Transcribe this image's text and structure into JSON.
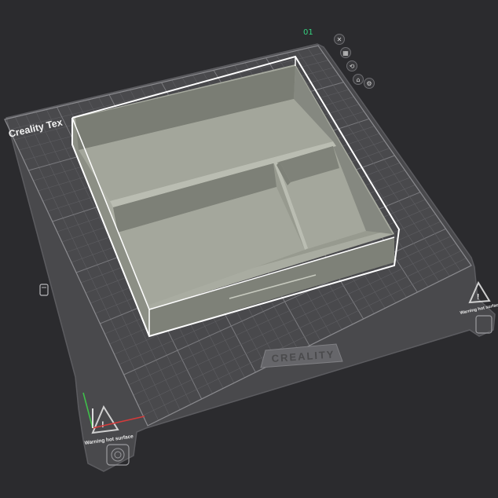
{
  "viewport": {
    "plate": {
      "title": "Creality Tex",
      "number": "01",
      "brand": "CREALITY",
      "warning_text": "Warning hot surface",
      "warning_symbol": "!"
    },
    "plate_tools": [
      {
        "name": "close-icon",
        "glyph": "✕"
      },
      {
        "name": "arrange-icon",
        "glyph": "▦"
      },
      {
        "name": "orient-icon",
        "glyph": "⟲"
      },
      {
        "name": "lock-icon",
        "glyph": "⌂"
      },
      {
        "name": "settings-icon",
        "glyph": "⚙"
      }
    ],
    "model": {
      "type": "divided box",
      "color": "#9b9e93",
      "selected_outline": "#ffffff"
    },
    "axes": {
      "x_color": "#d43b3b",
      "y_color": "#3fbf4a",
      "z_color": "#ffffff"
    },
    "colors": {
      "background": "#2b2b2e",
      "plate": "#48484b",
      "grid_line": "#6a6a6d",
      "accent": "#35d07f"
    }
  }
}
